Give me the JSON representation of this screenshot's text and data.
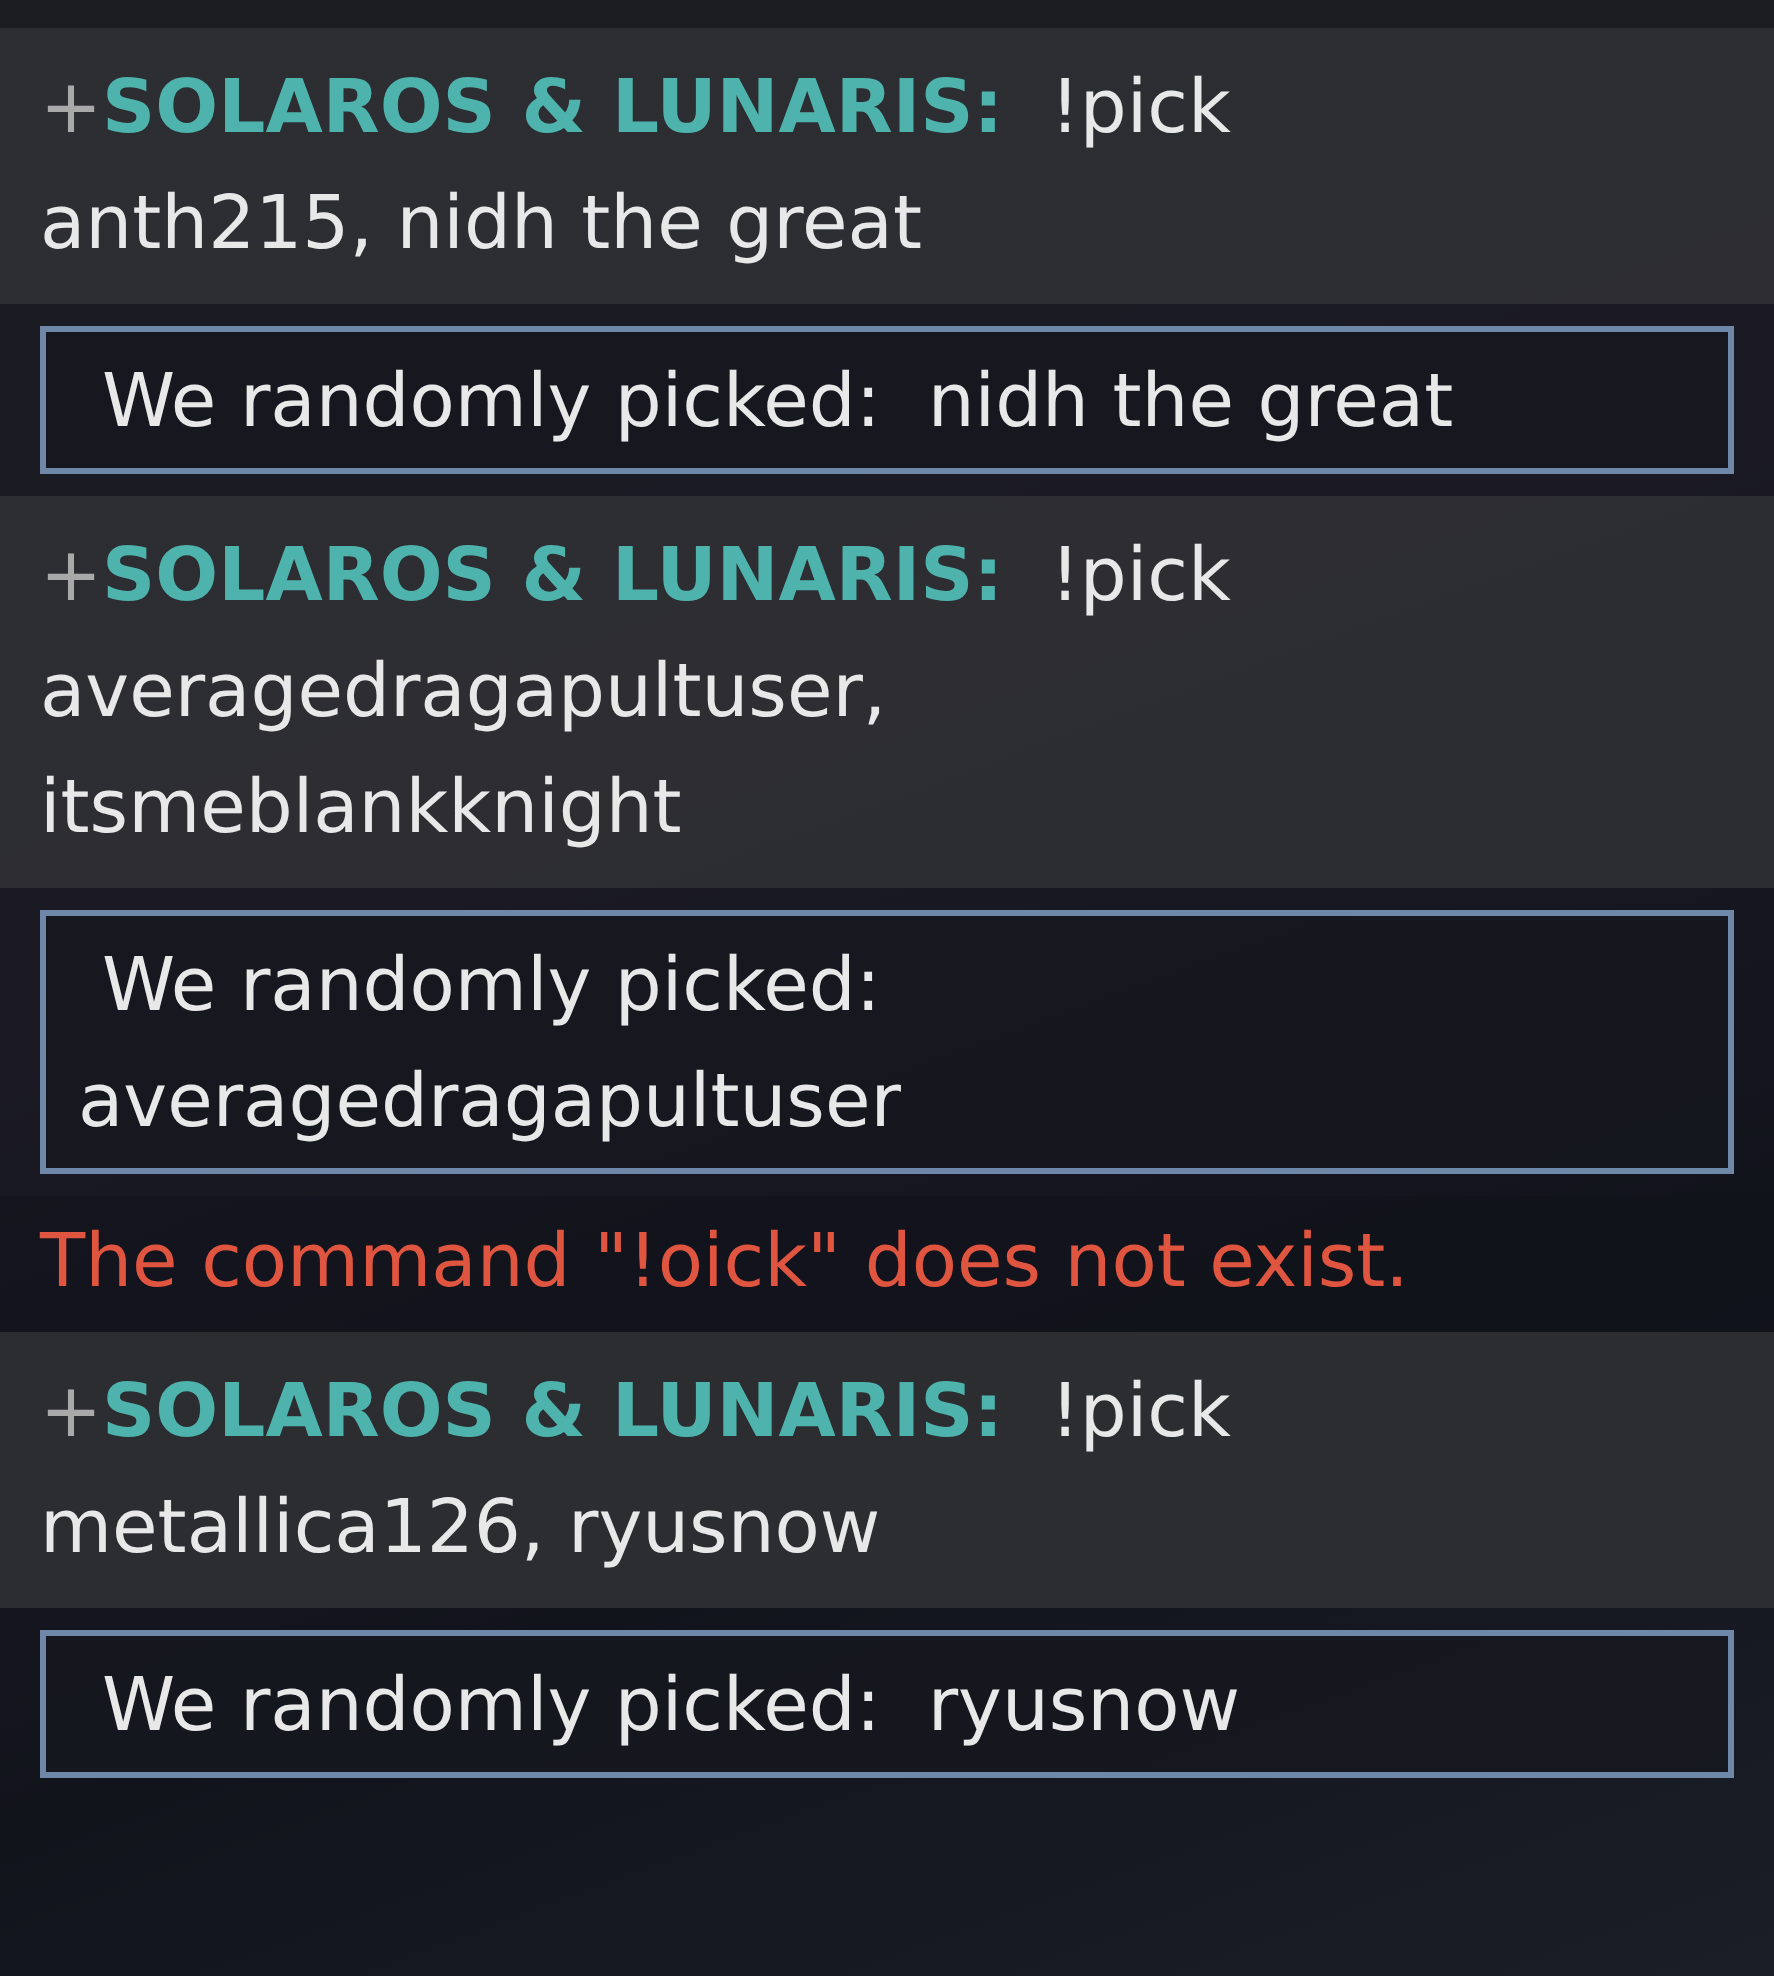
{
  "messages": [
    {
      "kind": "chat",
      "rank": "+",
      "name": "SOLAROS & LUNARIS:",
      "text": "!pick anth215, nidh the great"
    },
    {
      "kind": "result",
      "label": "We randomly picked:",
      "value": "nidh the great"
    },
    {
      "kind": "chat",
      "rank": "+",
      "name": "SOLAROS & LUNARIS:",
      "text": "!pick averagedragapultuser, itsmeblankknight"
    },
    {
      "kind": "result",
      "label": "We randomly picked:",
      "value": "averagedragapultuser"
    },
    {
      "kind": "error",
      "text": "The command \"!oick\" does not exist."
    },
    {
      "kind": "chat",
      "rank": "+",
      "name": "SOLAROS & LUNARIS:",
      "text": "!pick metallica126, ryusnow"
    },
    {
      "kind": "result",
      "label": "We randomly picked:",
      "value": "ryusnow"
    }
  ]
}
